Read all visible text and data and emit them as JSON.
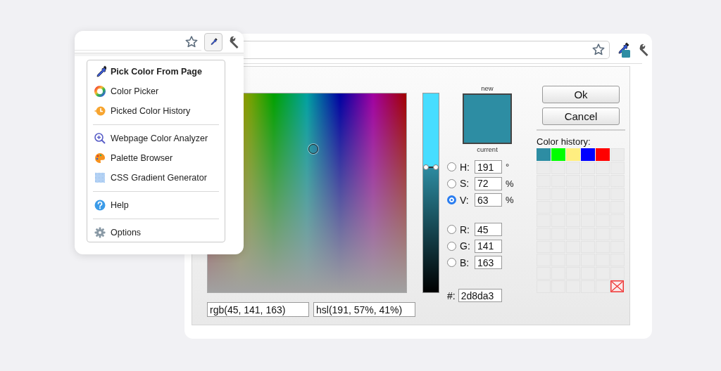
{
  "popup": {
    "menu_groups": [
      [
        {
          "label": "Pick Color From Page",
          "emphasized": true
        },
        {
          "label": "Color Picker",
          "emphasized": false
        },
        {
          "label": "Picked Color History",
          "emphasized": false
        }
      ],
      [
        {
          "label": "Webpage Color Analyzer",
          "emphasized": false
        },
        {
          "label": "Palette Browser",
          "emphasized": false
        },
        {
          "label": "CSS Gradient Generator",
          "emphasized": false
        }
      ],
      [
        {
          "label": "Help",
          "emphasized": false
        }
      ],
      [
        {
          "label": "Options",
          "emphasized": false
        }
      ]
    ]
  },
  "dialog": {
    "preview": {
      "new_label": "new",
      "current_label": "current"
    },
    "value_slider": {
      "level": 0.63
    },
    "hsv_channels": [
      {
        "label": "H:",
        "value": "191",
        "unit": "°",
        "selected": false
      },
      {
        "label": "S:",
        "value": "72",
        "unit": "%",
        "selected": false
      },
      {
        "label": "V:",
        "value": "63",
        "unit": "%",
        "selected": true
      }
    ],
    "rgb_channels": [
      {
        "label": "R:",
        "value": "45",
        "selected": false
      },
      {
        "label": "G:",
        "value": "141",
        "selected": false
      },
      {
        "label": "B:",
        "value": "163",
        "selected": false
      }
    ],
    "hex": {
      "label": "#:",
      "value": "2d8da3"
    },
    "buttons": [
      {
        "label": "Ok"
      },
      {
        "label": "Cancel"
      }
    ],
    "history": {
      "title": "Color history:",
      "swatches": [
        {
          "color": "#2d8da3"
        },
        {
          "color": "#00ff00"
        },
        {
          "color": "#ffee80"
        },
        {
          "color": "#0000ff"
        },
        {
          "color": "#ff0000"
        }
      ]
    },
    "rgb_field": {
      "value": "rgb(45, 141, 163)"
    },
    "hsl_field": {
      "value": "hsl(191, 57%, 41%)"
    }
  }
}
